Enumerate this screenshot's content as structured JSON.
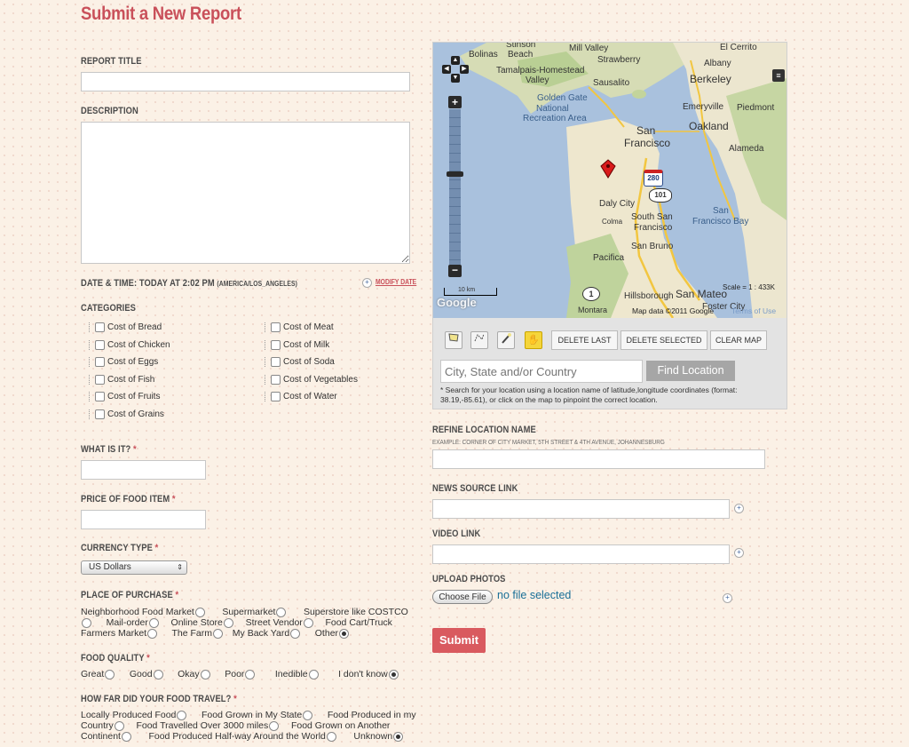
{
  "page_title": "Submit a New Report",
  "report_title": {
    "label": "REPORT TITLE",
    "value": ""
  },
  "description": {
    "label": "DESCRIPTION",
    "value": ""
  },
  "datetime": {
    "label": "DATE & TIME: TODAY AT 2:02 PM",
    "tz": "(AMERICA/LOS_ANGELES)",
    "modify": "MODIFY DATE"
  },
  "categories": {
    "label": "CATEGORIES",
    "left": [
      "Cost of Bread",
      "Cost of Chicken",
      "Cost of Eggs",
      "Cost of Fish",
      "Cost of Fruits",
      "Cost of Grains"
    ],
    "right": [
      "Cost of Meat",
      "Cost of Milk",
      "Cost of Soda",
      "Cost of Vegetables",
      "Cost of Water"
    ]
  },
  "what_is_it": {
    "label": "WHAT IS IT?",
    "value": ""
  },
  "price": {
    "label": "PRICE OF FOOD ITEM",
    "value": ""
  },
  "currency": {
    "label": "CURRENCY TYPE",
    "selected": "US Dollars"
  },
  "place": {
    "label": "PLACE OF PURCHASE",
    "options": [
      "Neighborhood Food Market",
      "Supermarket",
      "Superstore like COSTCO",
      "Mail-order",
      "Online Store",
      "Street Vendor",
      "Food Cart/Truck",
      "Farmers Market",
      "The Farm",
      "My Back Yard",
      "Other"
    ],
    "selected": "Other"
  },
  "quality": {
    "label": "FOOD QUALITY",
    "options": [
      "Great",
      "Good",
      "Okay",
      "Poor",
      "Inedible",
      "I don't know"
    ],
    "selected": "I don't know"
  },
  "travel": {
    "label": "HOW FAR DID YOUR FOOD TRAVEL?",
    "options": [
      "Locally Produced Food",
      "Food Grown in My State",
      "Food Produced in my Country",
      "Food Travelled Over 3000 miles",
      "Food Grown on Another Continent",
      "Food Produced Half-way Around the World",
      "Unknown"
    ],
    "line1": [
      "Locally Produced Food",
      "Food Grown in My State",
      "Food Produced in my"
    ],
    "line2": [
      "Country",
      "Food Travelled Over 3000 miles",
      "Food Grown on Another"
    ],
    "line3": [
      "Continent",
      "Food Produced Half-way Around the World",
      "Unknown"
    ],
    "selected": "Unknown"
  },
  "map": {
    "labels": {
      "stinson": "Stinson",
      "bolinas": "Bolinas",
      "beach": "Beach",
      "mill_valley": "Mill Valley",
      "strawberry": "Strawberry",
      "el_cerrito": "El Cerrito",
      "albany": "Albany",
      "tamalpais": "Tamalpais-Homestead",
      "valley": "Valley",
      "sausalito": "Sausalito",
      "berkeley": "Berkeley",
      "golden_gate": "Golden Gate",
      "national": "National",
      "recreation": "Recreation Area",
      "emeryville": "Emeryville",
      "piedmont": "Piedmont",
      "san": "San",
      "francisco": "Francisco",
      "oakland": "Oakland",
      "alameda": "Alameda",
      "daly": "Daly City",
      "colma": "Colma",
      "south_san": "South San",
      "francisco2": "Francisco",
      "san_bay": "San",
      "francisco_bay": "Francisco Bay",
      "san_bruno": "San Bruno",
      "pacifica": "Pacifica",
      "hillsborough": "Hillsborough",
      "san_mateo": "San Mateo",
      "foster": "Foster City",
      "montara": "Montara",
      "i280": "280",
      "r101": "101",
      "r1": "1"
    },
    "scale_bar": "10 km",
    "scale": "Scale = 1 : 433K",
    "attribution": "Map data ©2011 Google",
    "terms": "Terms of Use",
    "logo": "Google",
    "buttons": {
      "delete_last": "DELETE LAST",
      "delete_selected": "DELETE SELECTED",
      "clear_map": "CLEAR MAP"
    },
    "search_placeholder": "City, State and/or Country",
    "find_label": "Find Location",
    "hint": "* Search for your location using a location name of latitude,longitude coordinates (format: 38.19,-85.61), or click on the map to pinpoint the correct location."
  },
  "refine": {
    "label": "REFINE LOCATION NAME",
    "example": "EXAMPLE: CORNER OF CITY MARKET, 5TH STREET & 4TH AVENUE, JOHANNESBURG",
    "value": ""
  },
  "news": {
    "label": "NEWS SOURCE LINK",
    "value": ""
  },
  "video": {
    "label": "VIDEO LINK",
    "value": ""
  },
  "upload": {
    "label": "UPLOAD PHOTOS",
    "choose": "Choose File",
    "status": "no file selected"
  },
  "submit_label": "Submit",
  "colors": {
    "accent": "#c9505a",
    "background": "#fbf1e6",
    "link": "#1a6e96"
  }
}
